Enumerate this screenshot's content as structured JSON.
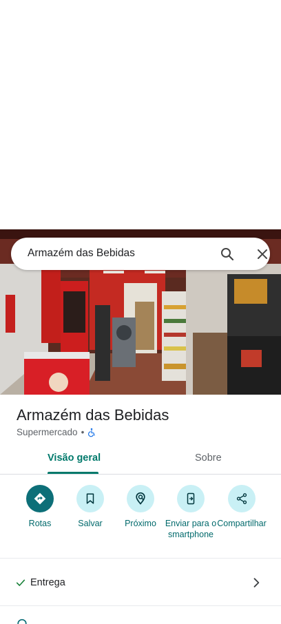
{
  "search": {
    "query": "Armazém das Bebidas"
  },
  "place": {
    "name": "Armazém das Bebidas",
    "category": "Supermercado",
    "separator": "•"
  },
  "tabs": [
    {
      "label": "Visão geral",
      "active": true
    },
    {
      "label": "Sobre",
      "active": false
    }
  ],
  "actions": [
    {
      "label": "Rotas",
      "icon": "directions-icon"
    },
    {
      "label": "Salvar",
      "icon": "bookmark-icon"
    },
    {
      "label": "Próximo",
      "icon": "nearby-icon"
    },
    {
      "label": "Enviar para o smartphone",
      "icon": "send-to-phone-icon"
    },
    {
      "label": "Compartilhar",
      "icon": "share-icon"
    }
  ],
  "attributes": [
    {
      "label": "Entrega",
      "icon": "check-icon"
    }
  ],
  "colors": {
    "accent": "#00796b",
    "action_bg": "#c9f0f5",
    "primary_action_bg": "#0d6f78"
  }
}
